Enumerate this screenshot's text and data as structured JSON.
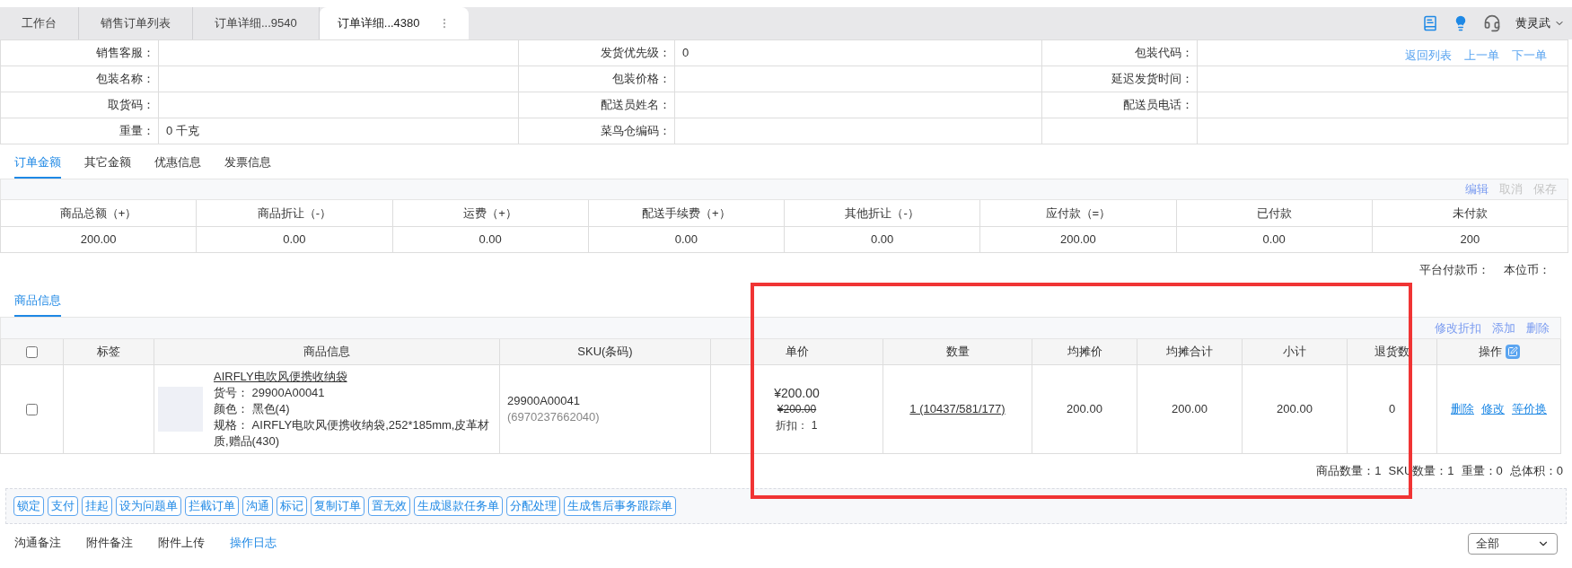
{
  "tabs": [
    {
      "label": "工作台",
      "selected": false
    },
    {
      "label": "销售订单列表",
      "selected": false
    },
    {
      "label": "订单详细...9540",
      "selected": false
    },
    {
      "label": "订单详细...4380",
      "selected": true
    }
  ],
  "header": {
    "user": "黄灵武"
  },
  "info_rows": [
    [
      {
        "label": "销售客服："
      },
      {
        "label": "发货优先级：",
        "value": "0"
      },
      {
        "label": "包装代码："
      }
    ],
    [
      {
        "label": "包装名称："
      },
      {
        "label": "包装价格："
      },
      {
        "label": "延迟发货时间："
      }
    ],
    [
      {
        "label": "取货码："
      },
      {
        "label": "配送员姓名："
      },
      {
        "label": "配送员电话："
      }
    ],
    [
      {
        "label": "重量：",
        "value": "0 千克"
      },
      {
        "label": "菜鸟仓编码："
      },
      {}
    ]
  ],
  "nav_links": [
    "返回列表",
    "上一单",
    "下一单"
  ],
  "amount_tabs": [
    {
      "label": "订单金额",
      "selected": true
    },
    {
      "label": "其它金额",
      "selected": false
    },
    {
      "label": "优惠信息",
      "selected": false
    },
    {
      "label": "发票信息",
      "selected": false
    }
  ],
  "amount_actions": [
    {
      "label": "编辑",
      "disabled": false
    },
    {
      "label": "取消",
      "disabled": true
    },
    {
      "label": "保存",
      "disabled": true
    }
  ],
  "amount_table": {
    "columns": [
      "商品总额（+）",
      "商品折让（-）",
      "运费（+）",
      "配送手续费（+）",
      "其他折让（-）",
      "应付款（=）",
      "已付款",
      "未付款"
    ],
    "values": [
      "200.00",
      "0.00",
      "0.00",
      "0.00",
      "0.00",
      "200.00",
      "0.00",
      "200"
    ]
  },
  "currency": [
    "平台付款币：",
    "本位币："
  ],
  "goods_tabs": [
    {
      "label": "商品信息",
      "selected": true
    }
  ],
  "goods_actions": [
    "修改折扣",
    "添加",
    "删除"
  ],
  "goods_table": {
    "header_checked": false,
    "columns": [
      "标签",
      "商品信息",
      "SKU(条码)",
      "单价",
      "数量",
      "均摊价",
      "均摊合计",
      "小计",
      "退货数",
      "操作"
    ],
    "rows": [
      {
        "checked": false,
        "name": "AIRFLY电吹风便携收纳袋",
        "details": [
          "货号： 29900A00041",
          "颜色： 黑色(4)",
          "规格： AIRFLY电吹风便携收纳袋,252*185mm,皮革材质,赠品(430)"
        ],
        "sku": "29900A00041",
        "barcode": "(6970237662040)",
        "price": "¥200.00",
        "original_price": "¥200.00",
        "discount": "折扣： 1",
        "quantity": "1 (10437/581/177)",
        "avg_price": "200.00",
        "avg_total": "200.00",
        "subtotal": "200.00",
        "returned": "0",
        "actions": [
          "删除",
          "修改",
          "等价换"
        ]
      }
    ]
  },
  "summary": [
    "商品数量：1",
    "SKU数量：1",
    "重量：0",
    "总体积：0"
  ],
  "action_buttons": [
    "锁定",
    "支付",
    "挂起",
    "设为问题单",
    "拦截订单",
    "沟通",
    "标记",
    "复制订单",
    "置无效",
    "生成退款任务单",
    "分配处理",
    "生成售后事务跟踪单"
  ],
  "bottom_tabs": [
    {
      "label": "沟通备注",
      "selected": false
    },
    {
      "label": "附件备注",
      "selected": false
    },
    {
      "label": "附件上传",
      "selected": false
    },
    {
      "label": "操作日志",
      "selected": true
    }
  ],
  "filter_select": {
    "value": "全部"
  }
}
